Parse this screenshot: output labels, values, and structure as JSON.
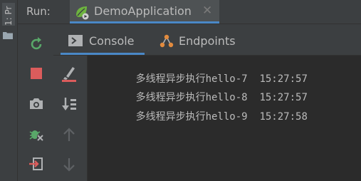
{
  "side_strip": {
    "label": "1: Pr",
    "icon": "folder-icon"
  },
  "run_panel": {
    "run_label": "Run:",
    "tab": {
      "label": "DemoApplication",
      "icon": "spring-boot-run-icon",
      "close": "✕"
    }
  },
  "toolbar": {
    "buttons": [
      "rerun-icon",
      "stop-icon",
      "camera-icon",
      "debug-bug-icon",
      "exit-icon"
    ],
    "secondary": [
      "clear-console-icon",
      "sort-down-icon",
      "arrow-up-icon",
      "arrow-down-icon"
    ]
  },
  "tabs": [
    {
      "label": "Console",
      "icon": "console-icon",
      "selected": true
    },
    {
      "label": "Endpoints",
      "icon": "endpoints-icon",
      "selected": false
    }
  ],
  "console": {
    "lines": [
      {
        "text": "多线程异步执行hello-7",
        "time": "15:27:57"
      },
      {
        "text": "多线程异步执行hello-8",
        "time": "15:27:57"
      },
      {
        "text": "多线程异步执行hello-9",
        "time": "15:27:58"
      }
    ]
  },
  "colors": {
    "background": "#2b2b2b",
    "panel": "#3c3f41",
    "accent": "#4a88c7",
    "text": "#bbbbbb",
    "rerun_green": "#59a869",
    "stop_red": "#db5c5c"
  }
}
